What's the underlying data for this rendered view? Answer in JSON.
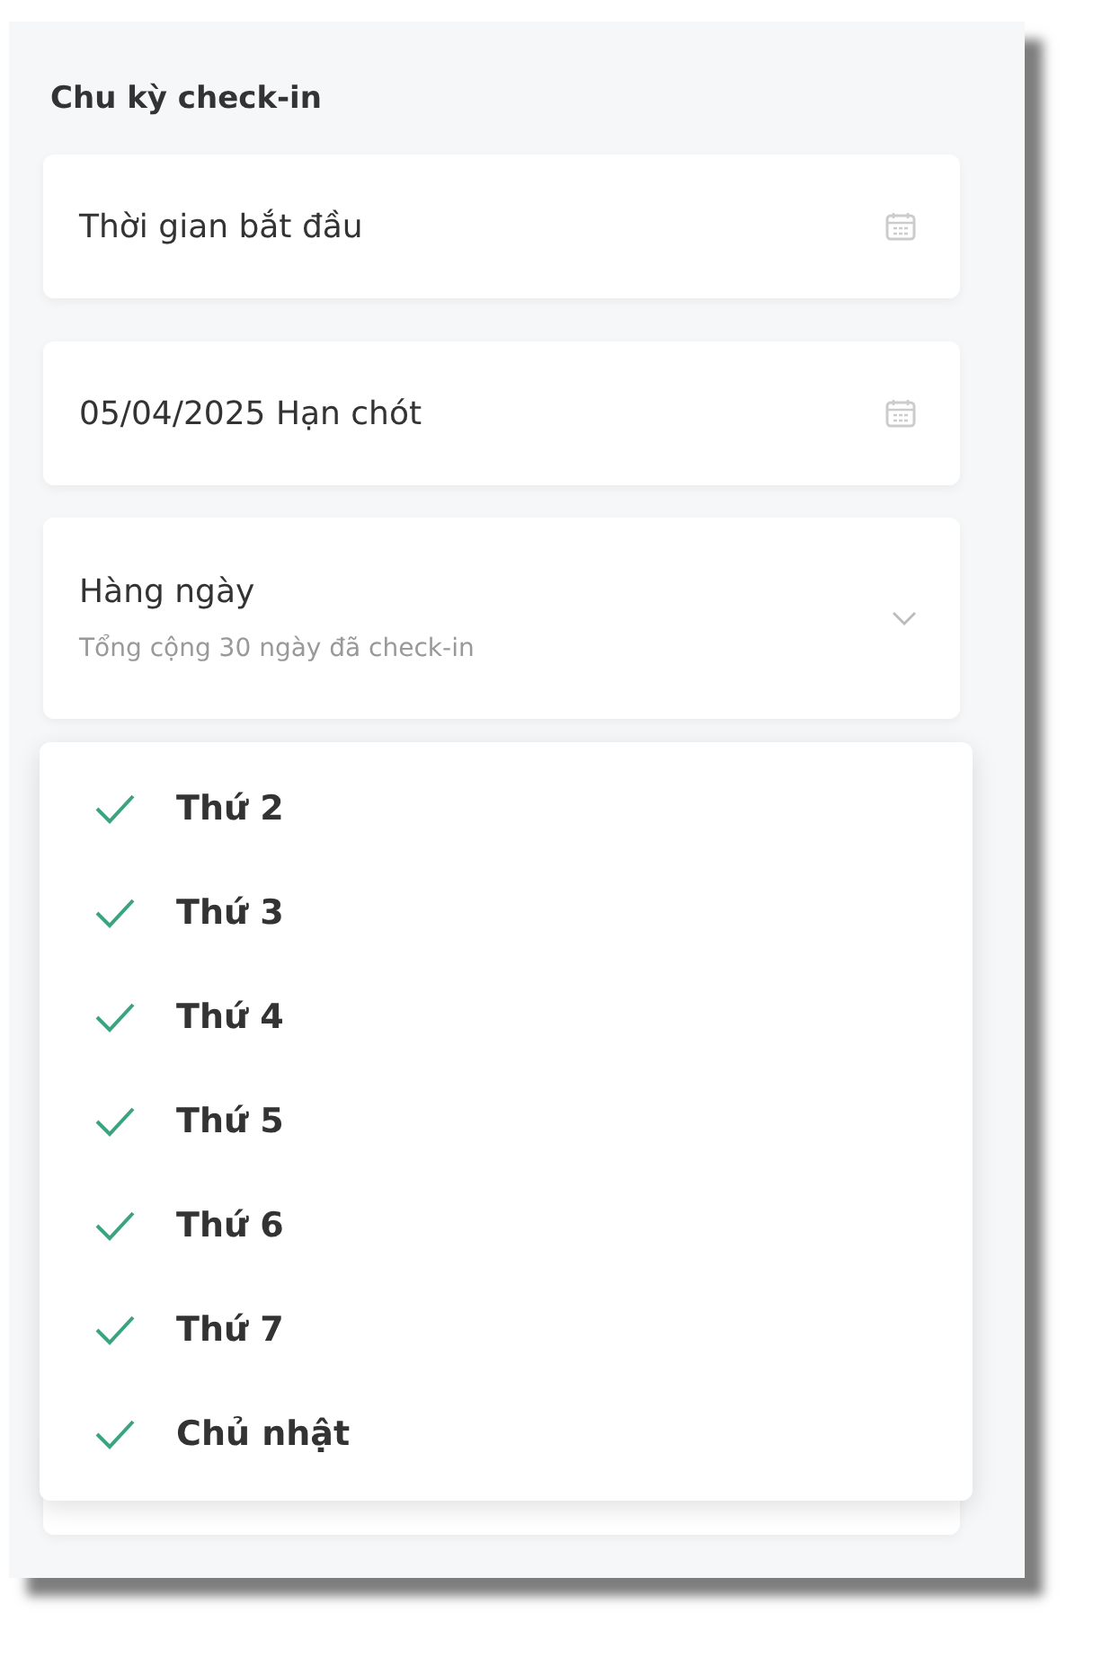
{
  "section_title": "Chu kỳ check-in",
  "fields": [
    {
      "kind": "date",
      "value": "Thời gian bắt đầu"
    },
    {
      "kind": "date",
      "value": "05/04/2025 Hạn chót"
    },
    {
      "kind": "select",
      "value": "Hàng ngày",
      "hint": "Tổng cộng 30 ngày đã check-in",
      "expanded": true
    }
  ],
  "dropdown": {
    "options": [
      {
        "label": "Thứ 2",
        "checked": true
      },
      {
        "label": "Thứ 3",
        "checked": true
      },
      {
        "label": "Thứ 4",
        "checked": true
      },
      {
        "label": "Thứ 5",
        "checked": true
      },
      {
        "label": "Thứ 6",
        "checked": true
      },
      {
        "label": "Thứ 7",
        "checked": true
      },
      {
        "label": "Chủ nhật",
        "checked": true
      }
    ]
  }
}
